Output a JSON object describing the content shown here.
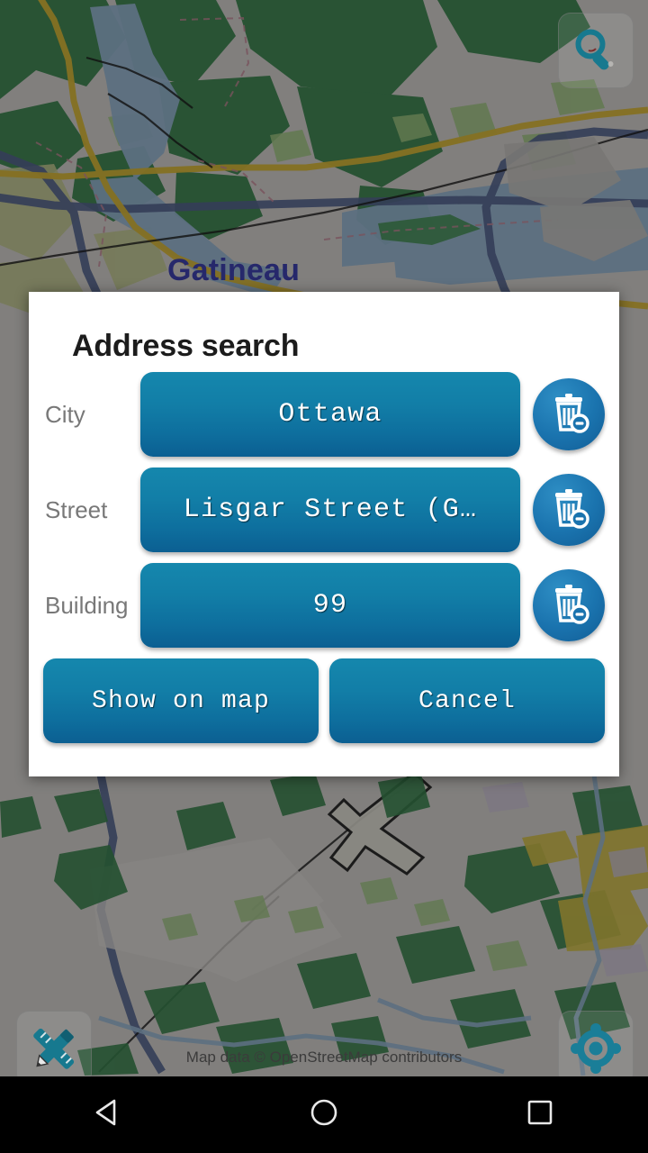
{
  "app": {
    "map_label": "Gatineau",
    "attribution": "Map data © OpenStreetMap contributors"
  },
  "map_controls": {
    "search": {
      "name": "search-icon",
      "label": "Search"
    },
    "measure": {
      "name": "ruler-pencil-icon",
      "label": "Measure"
    },
    "my_location": {
      "name": "crosshair-location-icon",
      "label": "My location"
    }
  },
  "dialog": {
    "title": "Address search",
    "fields": [
      {
        "label": "City",
        "value": "Ottawa",
        "clear_icon": "trash-minus-icon"
      },
      {
        "label": "Street",
        "value": "Lisgar Street (G…",
        "clear_icon": "trash-minus-icon"
      },
      {
        "label": "Building",
        "value": "99",
        "clear_icon": "trash-minus-icon"
      }
    ],
    "actions": {
      "confirm": "Show on map",
      "cancel": "Cancel"
    }
  },
  "navbar": {
    "back": "back-triangle-icon",
    "home": "home-circle-icon",
    "recents": "recents-square-icon"
  },
  "colors": {
    "accent_top": "#1587ad",
    "accent_bottom": "#0b5f92",
    "dialog_bg": "#ffffff",
    "label_grey": "#787878",
    "map_label": "#26286b",
    "icon_teal": "#17798f"
  }
}
